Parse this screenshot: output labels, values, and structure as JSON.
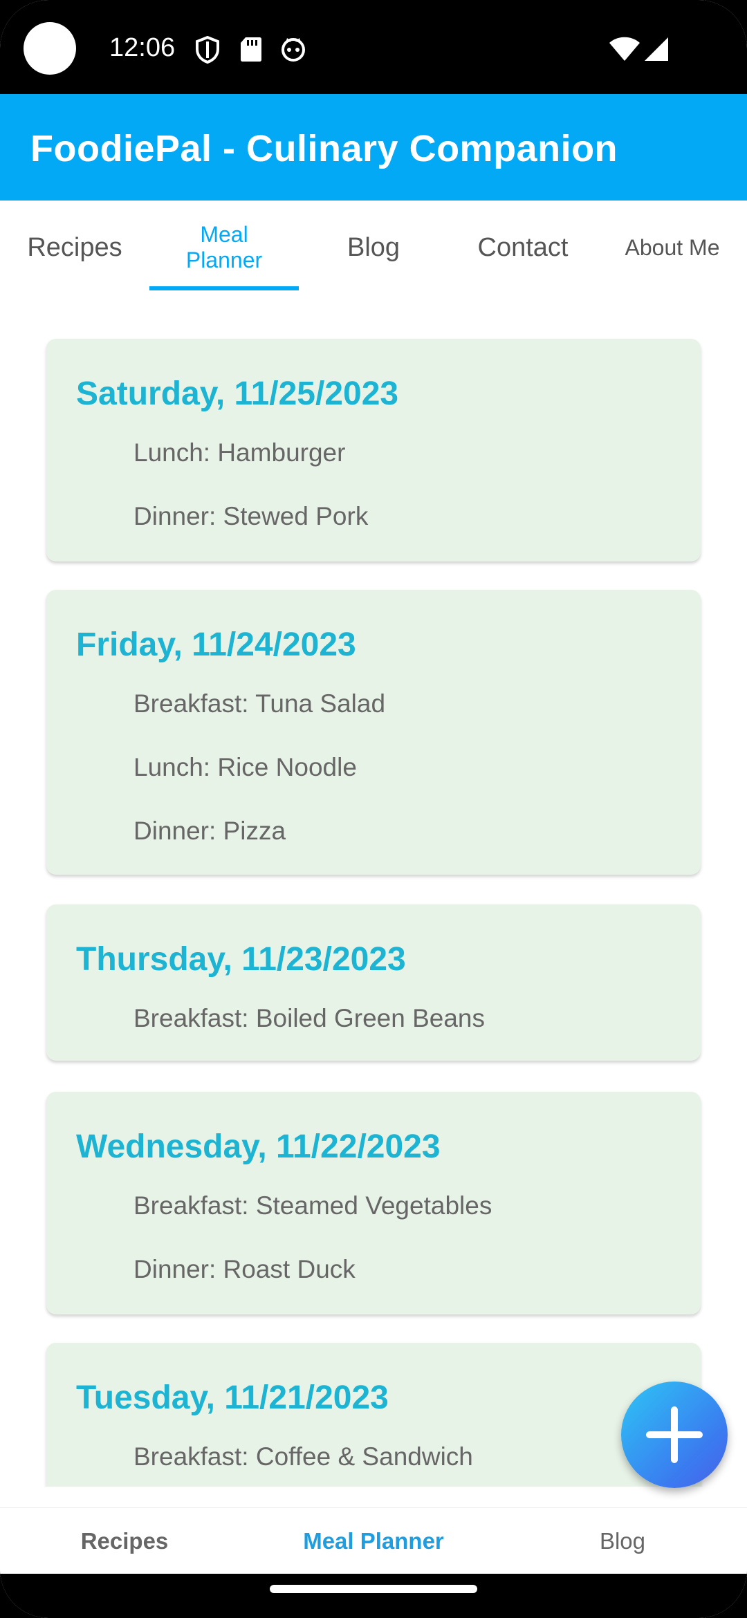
{
  "status_bar": {
    "time": "12:06",
    "icons": [
      "shield-icon",
      "sd-card-icon",
      "cat-face-icon",
      "wifi-icon",
      "signal-icon"
    ]
  },
  "app_bar": {
    "title": "FoodiePal - Culinary Companion",
    "color": "#03A9F4"
  },
  "tabs": [
    {
      "label": "Recipes",
      "active": false
    },
    {
      "label": "Meal Planner",
      "line1": "Meal",
      "line2": "Planner",
      "active": true
    },
    {
      "label": "Blog",
      "active": false
    },
    {
      "label": "Contact",
      "active": false
    },
    {
      "label": "About Me",
      "active": false
    }
  ],
  "meal_plans": [
    {
      "date": "Saturday, 11/25/2023",
      "meals": [
        "Lunch: Hamburger",
        "Dinner: Stewed Pork"
      ]
    },
    {
      "date": "Friday, 11/24/2023",
      "meals": [
        "Breakfast: Tuna Salad",
        "Lunch: Rice Noodle",
        "Dinner: Pizza"
      ]
    },
    {
      "date": "Thursday, 11/23/2023",
      "meals": [
        "Breakfast: Boiled Green Beans"
      ]
    },
    {
      "date": "Wednesday, 11/22/2023",
      "meals": [
        "Breakfast: Steamed Vegetables",
        "Dinner: Roast Duck"
      ]
    },
    {
      "date": "Tuesday, 11/21/2023",
      "meals": [
        "Breakfast: Coffee & Sandwich"
      ]
    }
  ],
  "fab": {
    "icon": "plus-icon"
  },
  "bottom_nav": [
    {
      "label": "Recipes",
      "active": false
    },
    {
      "label": "Meal Planner",
      "active": true
    },
    {
      "label": "Blog",
      "active": false
    }
  ],
  "colors": {
    "accent": "#03A9F4",
    "date_text": "#1DB3D3",
    "card_bg": "#E8F3E7"
  }
}
